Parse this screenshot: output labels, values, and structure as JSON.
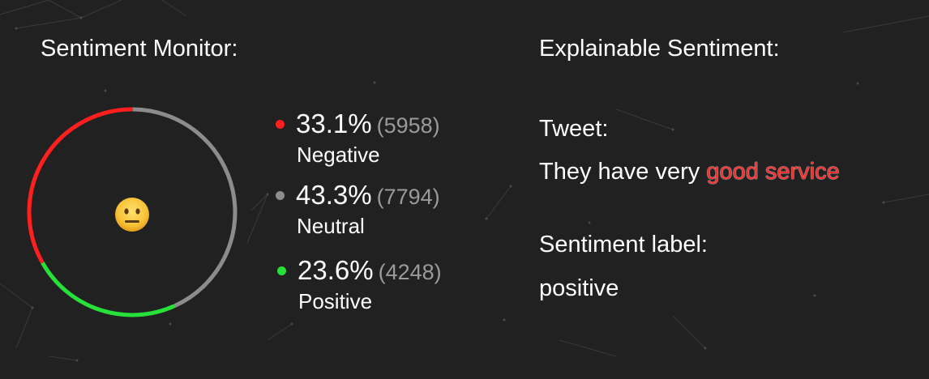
{
  "monitor": {
    "title": "Sentiment Monitor:",
    "face_icon": "neutral-face-icon",
    "items": [
      {
        "key": "negative",
        "percent": "33.1%",
        "count": "(5958)",
        "label": "Negative",
        "color": "#ff1f1f",
        "fraction": 0.331
      },
      {
        "key": "neutral",
        "percent": "43.3%",
        "count": "(7794)",
        "label": "Neutral",
        "color": "#8c8c8c",
        "fraction": 0.433
      },
      {
        "key": "positive",
        "percent": "23.6%",
        "count": "(4248)",
        "label": "Positive",
        "color": "#27e13a",
        "fraction": 0.236
      }
    ]
  },
  "explain": {
    "title": "Explainable Sentiment:",
    "tweet_label": "Tweet:",
    "tweet_prefix": "They have very ",
    "tweet_highlight": "good service",
    "highlight_color": "#ff2a2a",
    "sentiment_label": "Sentiment label:",
    "sentiment_value": "positive"
  }
}
